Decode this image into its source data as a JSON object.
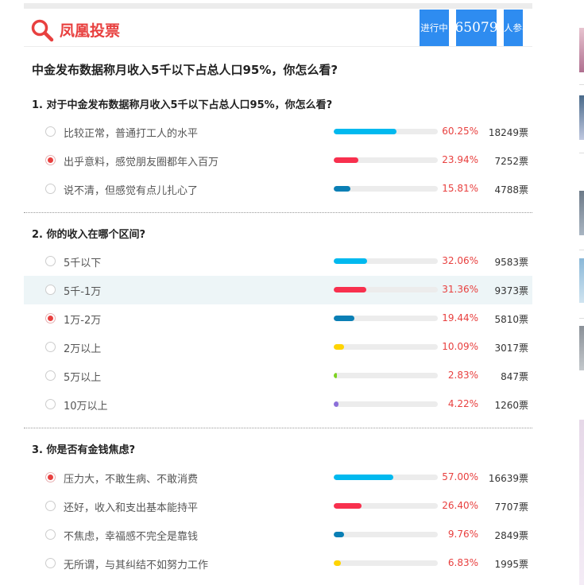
{
  "header": {
    "title": "凤凰投票",
    "status": "进行中",
    "participants": "65079",
    "participants_label": "人参与",
    "logo_icon": "magnifier-icon"
  },
  "page_title": "中金发布数据称月收入5千以下占总人口95%，你怎么看?",
  "colors": {
    "accent": "#e8403f",
    "badge": "#2e8cf0"
  },
  "questions": [
    {
      "title": "1. 对于中金发布数据称月收入5千以下占总人口95%，你怎么看?",
      "options": [
        {
          "label": "比较正常，普通打工人的水平",
          "percent": "60.25%",
          "votes": "18249票",
          "fraction": 0.6025,
          "color": "#00b9ef",
          "selected": false
        },
        {
          "label": "出乎意料，感觉朋友圈都年入百万",
          "percent": "23.94%",
          "votes": "7252票",
          "fraction": 0.2394,
          "color": "#f8304e",
          "selected": true
        },
        {
          "label": "说不清，但感觉有点儿扎心了",
          "percent": "15.81%",
          "votes": "4788票",
          "fraction": 0.1581,
          "color": "#0a7fb5",
          "selected": false
        }
      ]
    },
    {
      "title": "2. 你的收入在哪个区间?",
      "options": [
        {
          "label": "5千以下",
          "percent": "32.06%",
          "votes": "9583票",
          "fraction": 0.3206,
          "color": "#00b9ef",
          "selected": false
        },
        {
          "label": "5千-1万",
          "percent": "31.36%",
          "votes": "9373票",
          "fraction": 0.3136,
          "color": "#f8304e",
          "selected": false
        },
        {
          "label": "1万-2万",
          "percent": "19.44%",
          "votes": "5810票",
          "fraction": 0.1944,
          "color": "#0a7fb5",
          "selected": true
        },
        {
          "label": "2万以上",
          "percent": "10.09%",
          "votes": "3017票",
          "fraction": 0.1009,
          "color": "#ffd400",
          "selected": false
        },
        {
          "label": "5万以上",
          "percent": "2.83%",
          "votes": "847票",
          "fraction": 0.0283,
          "color": "#7ed321",
          "selected": false
        },
        {
          "label": "10万以上",
          "percent": "4.22%",
          "votes": "1260票",
          "fraction": 0.0422,
          "color": "#8b6fd9",
          "selected": false
        }
      ]
    },
    {
      "title": "3. 你是否有金钱焦虑?",
      "options": [
        {
          "label": "压力大，不敢生病、不敢消费",
          "percent": "57.00%",
          "votes": "16639票",
          "fraction": 0.57,
          "color": "#00b9ef",
          "selected": true
        },
        {
          "label": "还好，收入和支出基本能持平",
          "percent": "26.40%",
          "votes": "7707票",
          "fraction": 0.264,
          "color": "#f8304e",
          "selected": false
        },
        {
          "label": "不焦虑，幸福感不完全是靠钱",
          "percent": "9.76%",
          "votes": "2849票",
          "fraction": 0.0976,
          "color": "#0a7fb5",
          "selected": false
        },
        {
          "label": "无所谓，与其纠结不如努力工作",
          "percent": "6.83%",
          "votes": "1995票",
          "fraction": 0.0683,
          "color": "#ffd400",
          "selected": false
        }
      ]
    }
  ]
}
